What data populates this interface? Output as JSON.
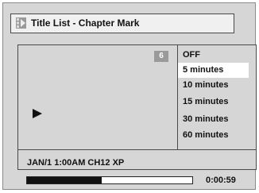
{
  "header": {
    "title": "Title List - Chapter Mark",
    "icon": "chapter-mark-icon"
  },
  "preview": {
    "chapter_number": "6",
    "play_icon": "play-icon"
  },
  "menu": {
    "items": [
      {
        "label": "OFF",
        "selected": false
      },
      {
        "label": "5 minutes",
        "selected": true
      },
      {
        "label": "10 minutes",
        "selected": false
      },
      {
        "label": "15 minutes",
        "selected": false
      },
      {
        "label": "30 minutes",
        "selected": false
      },
      {
        "label": "60 minutes",
        "selected": false
      }
    ]
  },
  "info": {
    "recording": "JAN/1 1:00AM CH12 XP",
    "elapsed_time": "0:00:59",
    "progress_fraction": 0.45
  }
}
